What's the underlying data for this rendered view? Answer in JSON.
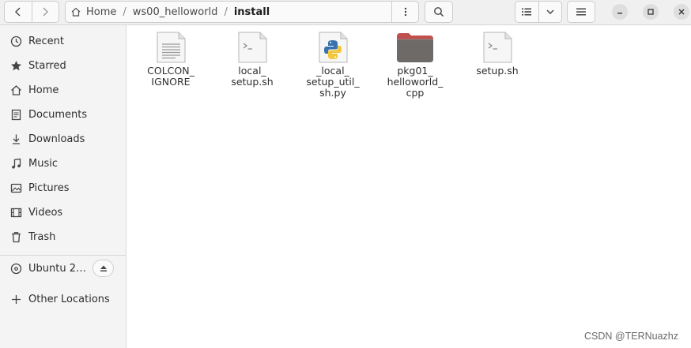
{
  "header": {
    "path": [
      "Home",
      "ws00_helloworld",
      "install"
    ],
    "path_separator": "/"
  },
  "sidebar": {
    "items": [
      {
        "label": "Recent",
        "icon": "clock-icon"
      },
      {
        "label": "Starred",
        "icon": "star-icon"
      },
      {
        "label": "Home",
        "icon": "home-icon"
      },
      {
        "label": "Documents",
        "icon": "document-icon"
      },
      {
        "label": "Downloads",
        "icon": "download-icon"
      },
      {
        "label": "Music",
        "icon": "music-icon"
      },
      {
        "label": "Pictures",
        "icon": "picture-icon"
      },
      {
        "label": "Videos",
        "icon": "video-icon"
      },
      {
        "label": "Trash",
        "icon": "trash-icon"
      }
    ],
    "device": {
      "label": "Ubuntu 2…",
      "icon": "disc-icon"
    },
    "other": {
      "label": "Other Locations",
      "icon": "plus-icon"
    }
  },
  "files": [
    {
      "name": "COLCON_\nIGNORE",
      "icon": "text-file-icon"
    },
    {
      "name": "local_\nsetup.sh",
      "icon": "script-file-icon"
    },
    {
      "name": "_local_\nsetup_util_\nsh.py",
      "icon": "python-file-icon"
    },
    {
      "name": "pkg01_\nhelloworld_\ncpp",
      "icon": "folder-icon"
    },
    {
      "name": "setup.sh",
      "icon": "script-file-icon"
    }
  ],
  "watermark": "CSDN @TERNuazhz",
  "colors": {
    "folder": "#6e6a68",
    "folder_tab": "#c0504d",
    "accent": "#e95420"
  }
}
